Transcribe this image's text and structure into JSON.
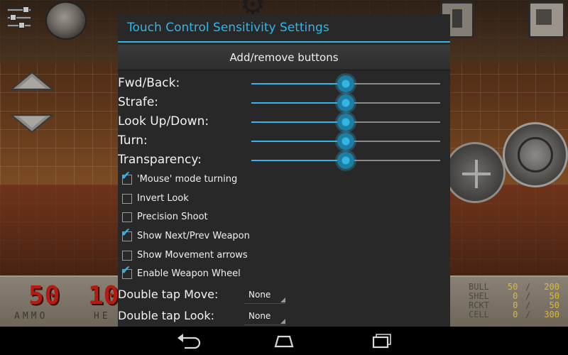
{
  "dialog": {
    "title": "Touch Control Sensitivity Settings",
    "add_remove_label": "Add/remove buttons",
    "sliders": [
      {
        "label": "Fwd/Back:",
        "value": 0.5
      },
      {
        "label": "Strafe:",
        "value": 0.5
      },
      {
        "label": "Look Up/Down:",
        "value": 0.5
      },
      {
        "label": "Turn:",
        "value": 0.5
      },
      {
        "label": "Transparency:",
        "value": 0.5
      }
    ],
    "checkboxes": [
      {
        "label": "'Mouse' mode turning",
        "checked": true
      },
      {
        "label": "Invert Look",
        "checked": false
      },
      {
        "label": "Precision Shoot",
        "checked": false
      },
      {
        "label": "Show Next/Prev Weapon",
        "checked": true
      },
      {
        "label": "Show Movement arrows",
        "checked": false
      },
      {
        "label": "Enable Weapon Wheel",
        "checked": true
      }
    ],
    "selects": [
      {
        "label": "Double tap Move:",
        "value": "None"
      },
      {
        "label": "Double tap Look:",
        "value": "None"
      }
    ],
    "accent_color": "#33b5e5"
  },
  "hud": {
    "ammo": "50",
    "ammo_label": "AMMO",
    "health": "10",
    "health_label": "HE",
    "ammo_table": [
      {
        "name": "BULL",
        "current": "50",
        "max": "200"
      },
      {
        "name": "SHEL",
        "current": "0",
        "max": "50"
      },
      {
        "name": "RCKT",
        "current": "0",
        "max": "50"
      },
      {
        "name": "CELL",
        "current": "0",
        "max": "300"
      }
    ]
  },
  "icons": {
    "sliders": "sliders-icon",
    "face": "player-face-icon",
    "gear": "gear-icon",
    "weapon1": "weapon-slot-icon",
    "weapon2": "weapon-slot-icon",
    "up": "move-up-arrow-icon",
    "down": "move-down-arrow-icon",
    "back": "back-icon",
    "home": "home-icon",
    "recents": "recents-icon"
  }
}
